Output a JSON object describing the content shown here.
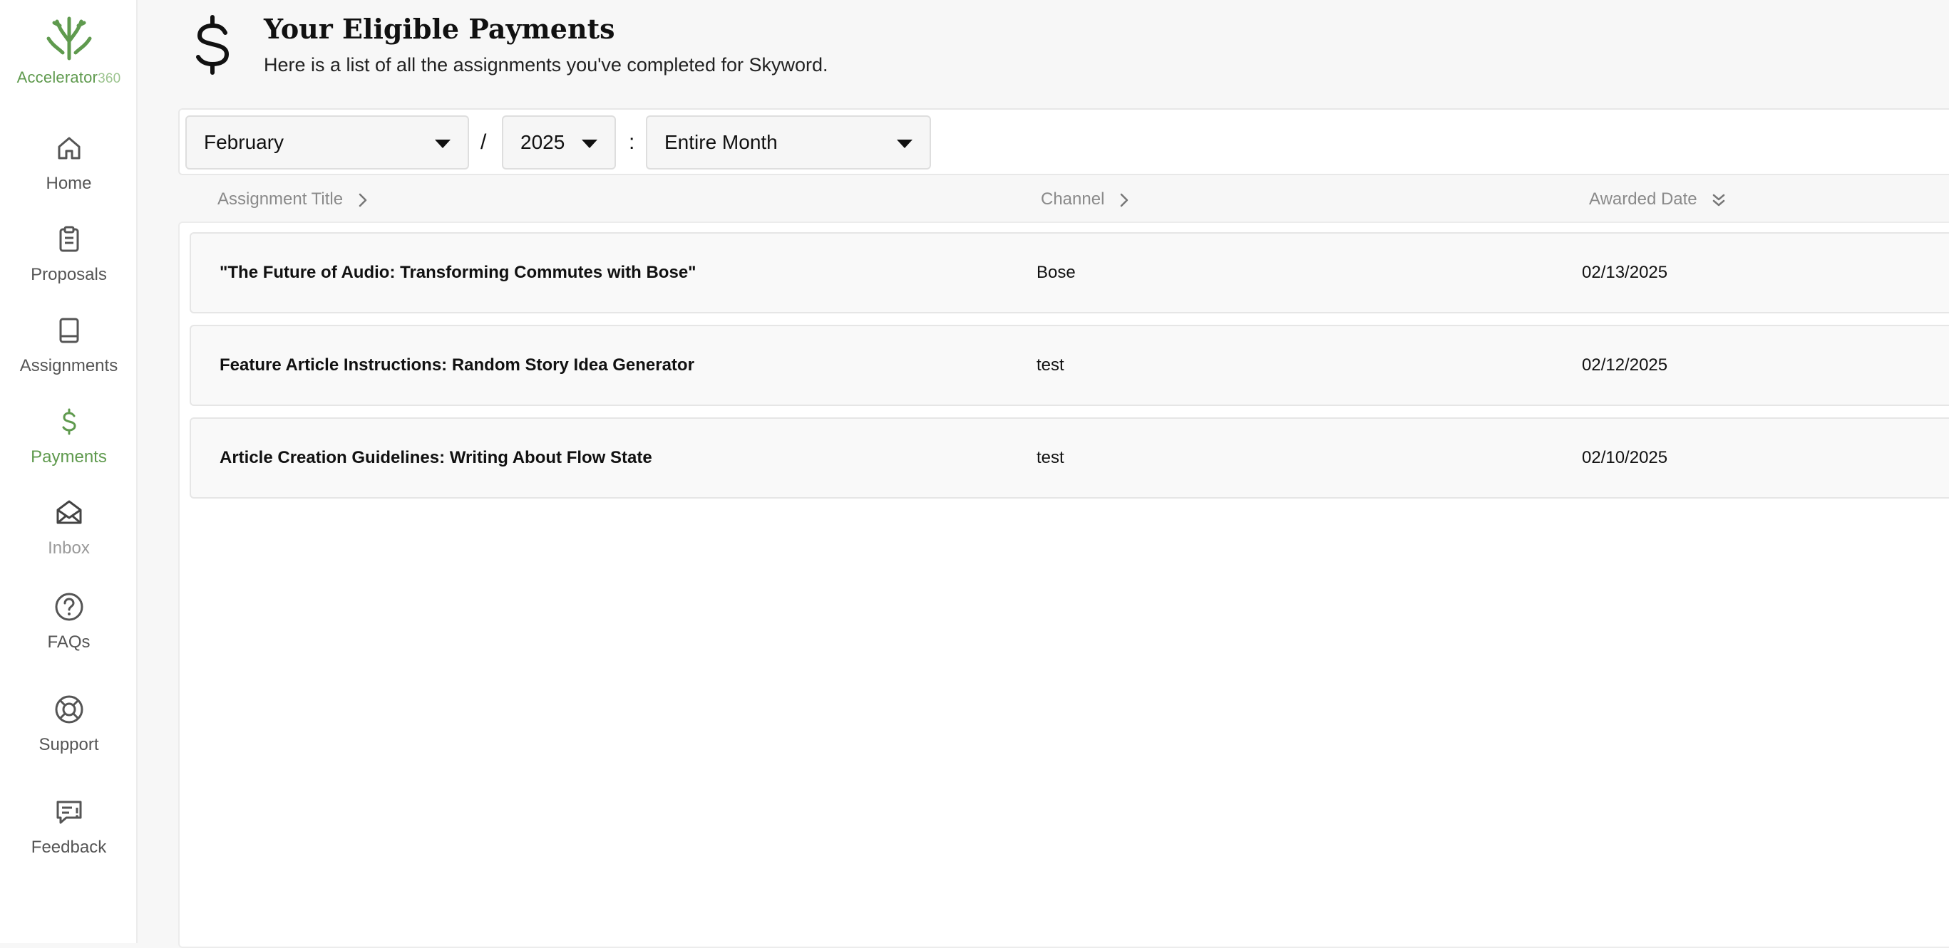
{
  "brand": {
    "name": "Accelerator",
    "suffix": "360"
  },
  "nav": [
    {
      "key": "home",
      "label": "Home"
    },
    {
      "key": "proposals",
      "label": "Proposals"
    },
    {
      "key": "assignments",
      "label": "Assignments"
    },
    {
      "key": "payments",
      "label": "Payments"
    },
    {
      "key": "inbox",
      "label": "Inbox"
    },
    {
      "key": "faqs",
      "label": "FAQs"
    },
    {
      "key": "support",
      "label": "Support"
    },
    {
      "key": "feedback",
      "label": "Feedback"
    }
  ],
  "active_nav": "Payments",
  "header": {
    "title": "Your Eligible Payments",
    "subtitle": "Here is a list of all the assignments you've completed for Skyword.",
    "icon": "dollar-icon"
  },
  "filters": {
    "month": "February",
    "separator_slash": "/",
    "year": "2025",
    "separator_colon": ":",
    "range": "Entire Month"
  },
  "table": {
    "columns": {
      "title": "Assignment Title",
      "channel": "Channel",
      "awarded_date": "Awarded Date"
    },
    "rows": [
      {
        "title": "\"The Future of Audio: Transforming Commutes with Bose\"",
        "channel": "Bose",
        "date": "02/13/2025"
      },
      {
        "title": "Feature Article Instructions: Random Story Idea Generator",
        "channel": "test",
        "date": "02/12/2025"
      },
      {
        "title": "Article Creation Guidelines: Writing About Flow State",
        "channel": "test",
        "date": "02/10/2025"
      }
    ]
  },
  "colors": {
    "accent": "#5f9a4e",
    "sidebar_bg": "#ffffff",
    "page_bg": "#f7f7f7"
  }
}
